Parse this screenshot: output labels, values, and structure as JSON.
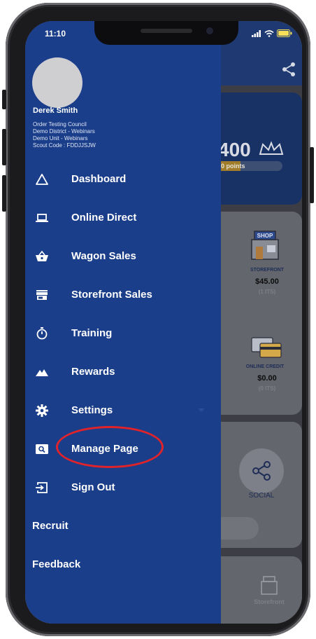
{
  "status_bar": {
    "time": "11:10"
  },
  "user": {
    "name": "Derek Smith",
    "details": [
      "Order Testing Council",
      "Demo District - Webinars",
      "Demo Unit - Webinars",
      "Scout Code : FDDJJSJW"
    ]
  },
  "menu": {
    "items": [
      {
        "label": "Dashboard",
        "icon": "triangle-outline-icon"
      },
      {
        "label": "Online Direct",
        "icon": "laptop-icon"
      },
      {
        "label": "Wagon Sales",
        "icon": "basket-icon"
      },
      {
        "label": "Storefront Sales",
        "icon": "storefront-icon"
      },
      {
        "label": "Training",
        "icon": "stopwatch-icon"
      },
      {
        "label": "Rewards",
        "icon": "mountain-icon"
      },
      {
        "label": "Settings",
        "icon": "gear-icon"
      },
      {
        "label": "Manage Page",
        "icon": "manage-page-icon"
      },
      {
        "label": "Sign Out",
        "icon": "sign-out-icon"
      }
    ],
    "links": [
      "Recruit",
      "Feedback"
    ]
  },
  "background": {
    "points_value": "400",
    "points_label": "0 points",
    "progress_fraction": 0.38,
    "storefront": {
      "label": "STOREFRONT",
      "amount": "$45.00",
      "sub": "(1 ITS)"
    },
    "online_credit": {
      "label": "ONLINE CREDIT",
      "amount": "$0.00",
      "sub": "(0 ITS)"
    },
    "social_label": "SOCIAL",
    "bottom_label": "Storefront"
  },
  "colors": {
    "drawer": "#1a3e8a",
    "highlight": "#e0232a"
  }
}
